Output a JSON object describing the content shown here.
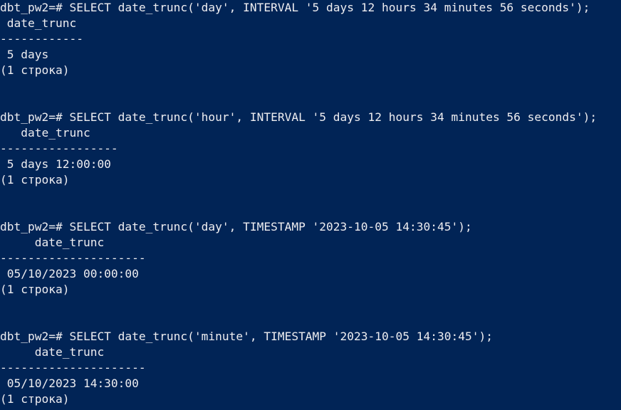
{
  "colors": {
    "background": "#012456",
    "text": "#eeedf0"
  },
  "terminal": {
    "lines": [
      "dbt_pw2=# SELECT date_trunc('day', INTERVAL '5 days 12 hours 34 minutes 56 seconds');",
      " date_trunc",
      "------------",
      " 5 days",
      "(1 строка)",
      "",
      "",
      "dbt_pw2=# SELECT date_trunc('hour', INTERVAL '5 days 12 hours 34 minutes 56 seconds');",
      "   date_trunc",
      "-----------------",
      " 5 days 12:00:00",
      "(1 строка)",
      "",
      "",
      "dbt_pw2=# SELECT date_trunc('day', TIMESTAMP '2023-10-05 14:30:45');",
      "     date_trunc",
      "---------------------",
      " 05/10/2023 00:00:00",
      "(1 строка)",
      "",
      "",
      "dbt_pw2=# SELECT date_trunc('minute', TIMESTAMP '2023-10-05 14:30:45');",
      "     date_trunc",
      "---------------------",
      " 05/10/2023 14:30:00",
      "(1 строка)"
    ]
  }
}
